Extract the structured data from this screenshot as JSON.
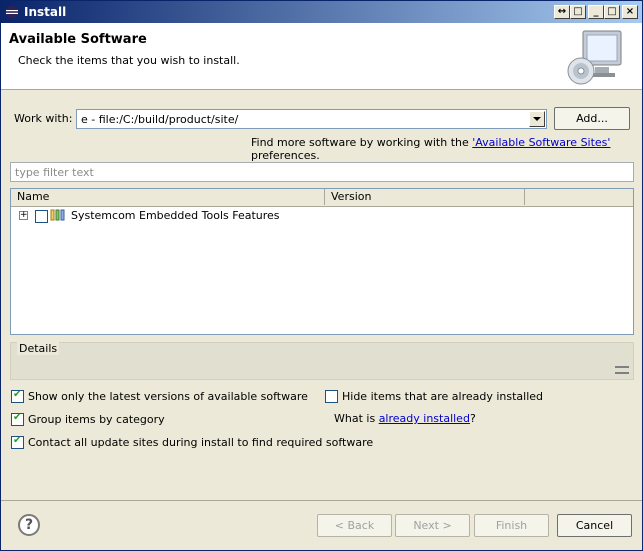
{
  "window": {
    "title": "Install",
    "controls": [
      "back-forward-icon",
      "restore-icon",
      "minimize-icon",
      "maximize-icon",
      "close-icon"
    ]
  },
  "header": {
    "title": "Available Software",
    "description": "Check the items that you wish to install."
  },
  "work_with": {
    "label": "Work with:",
    "value": "e - file:/C:/build/product/site/",
    "add_button": "Add...",
    "hint_prefix": "Find more software by working with the ",
    "hint_link": "'Available Software Sites'",
    "hint_suffix": " preferences."
  },
  "filter": {
    "placeholder": "type filter text"
  },
  "tree": {
    "columns": [
      "Name",
      "Version"
    ],
    "rows": [
      {
        "expander": "+",
        "checked": false,
        "icon": "feature-group-icon",
        "name": "Systemcom Embedded Tools Features",
        "version": ""
      }
    ]
  },
  "details": {
    "title": "Details"
  },
  "options": {
    "show_latest": {
      "label": "Show only the latest versions of available software",
      "checked": true
    },
    "group_by_category": {
      "label": "Group items by category",
      "checked": true
    },
    "contact_sites": {
      "label": "Contact all update sites during install to find required software",
      "checked": true
    },
    "hide_installed": {
      "label": "Hide items that are already installed",
      "checked": false
    },
    "what_is_prefix": "What is ",
    "what_is_link": "already installed",
    "what_is_suffix": "?"
  },
  "footer": {
    "help_icon": "?",
    "back_button": "< Back",
    "next_button": "Next >",
    "finish_button": "Finish",
    "cancel_button": "Cancel"
  }
}
